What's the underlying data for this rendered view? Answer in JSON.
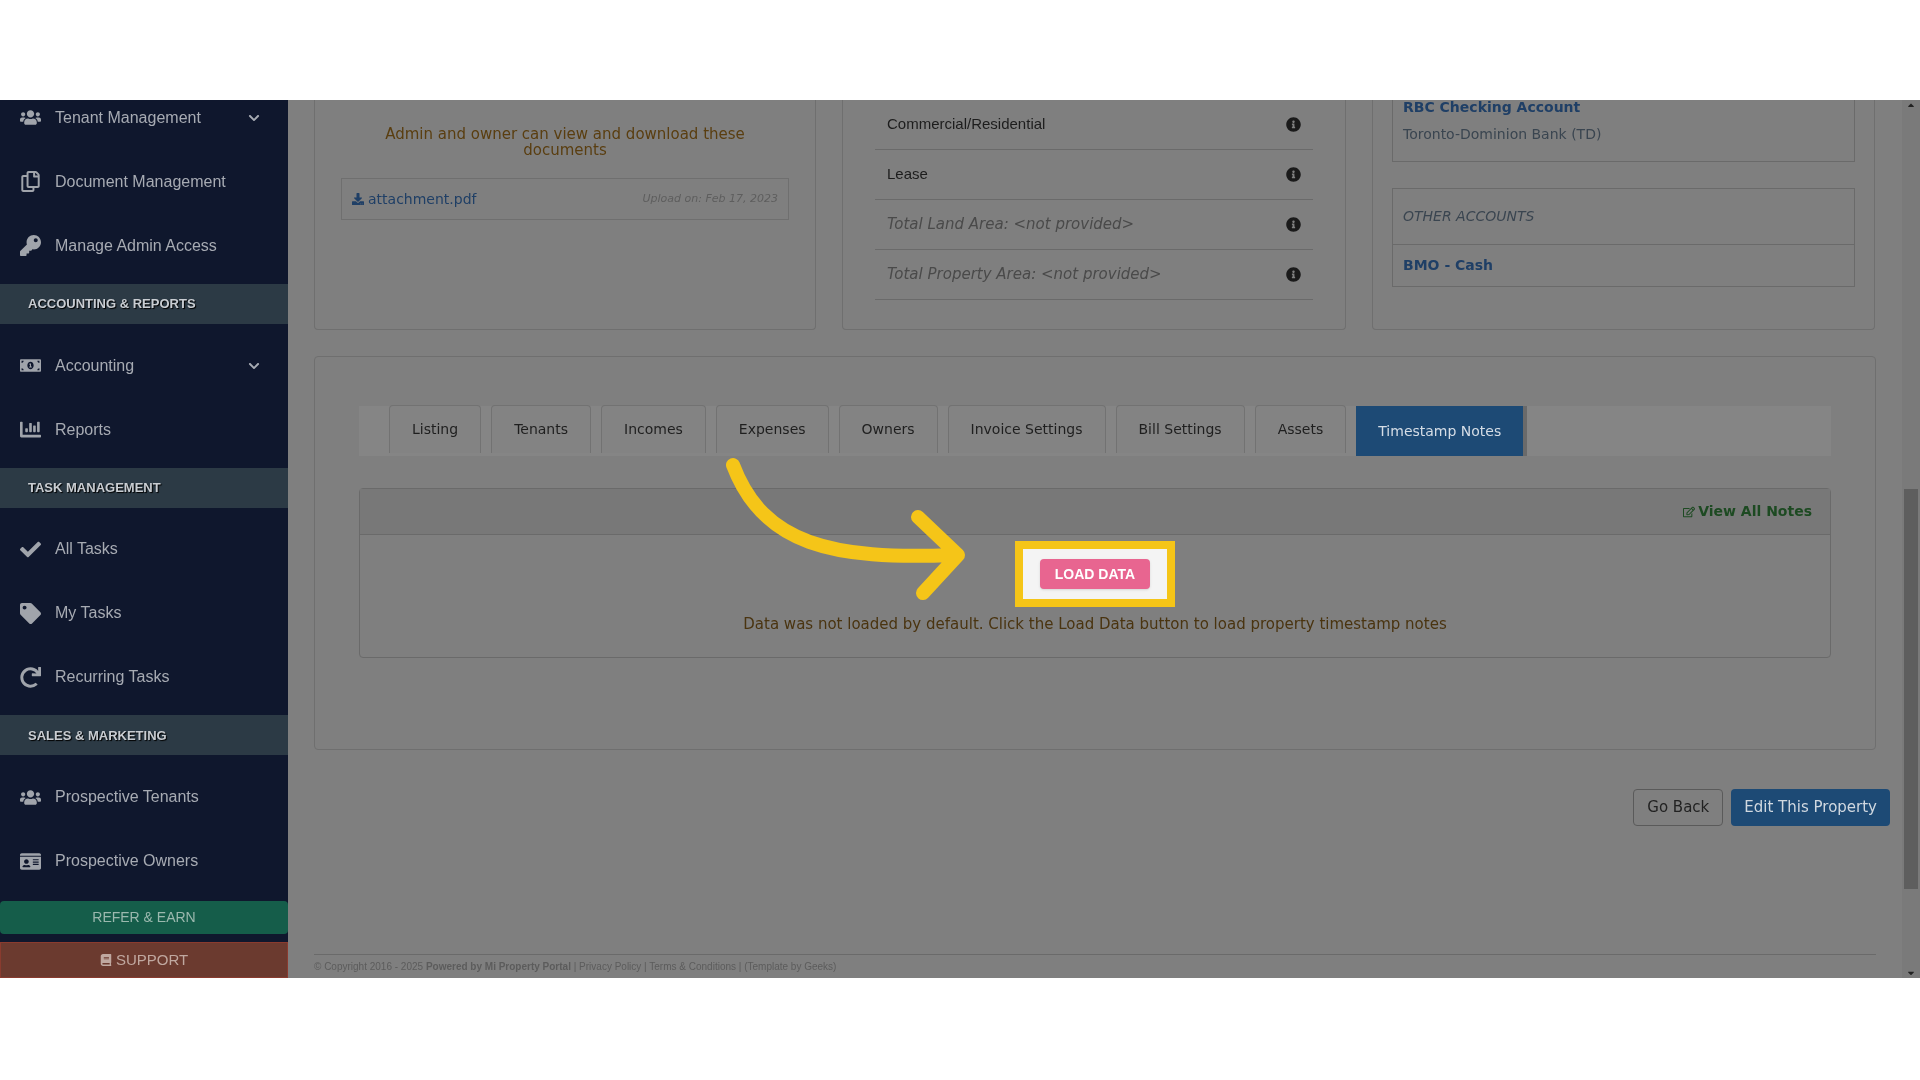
{
  "sidebar": {
    "items": [
      {
        "kind": "item",
        "label": "Tenant Management",
        "has_submenu": true
      },
      {
        "kind": "item",
        "label": "Document Management",
        "has_submenu": false
      },
      {
        "kind": "item",
        "label": "Manage Admin Access",
        "has_submenu": false
      },
      {
        "kind": "header",
        "label": "ACCOUNTING & REPORTS"
      },
      {
        "kind": "item",
        "label": "Accounting",
        "has_submenu": true
      },
      {
        "kind": "item",
        "label": "Reports",
        "has_submenu": false
      },
      {
        "kind": "header",
        "label": "TASK MANAGEMENT"
      },
      {
        "kind": "item",
        "label": "All Tasks",
        "has_submenu": false
      },
      {
        "kind": "item",
        "label": "My Tasks",
        "has_submenu": false
      },
      {
        "kind": "item",
        "label": "Recurring Tasks",
        "has_submenu": false
      },
      {
        "kind": "header",
        "label": "SALES & MARKETING"
      },
      {
        "kind": "item",
        "label": "Prospective Tenants",
        "has_submenu": false
      },
      {
        "kind": "item",
        "label": "Prospective Owners",
        "has_submenu": false
      },
      {
        "kind": "refer",
        "label": "REFER & EARN"
      },
      {
        "kind": "support",
        "label": "SUPPORT"
      }
    ]
  },
  "documents": {
    "heading": "Admin and owner can view and download these documents",
    "files": [
      {
        "name": "attachment.pdf",
        "uploaded": "Upload on: Feb 17, 2023"
      }
    ]
  },
  "property_details": [
    {
      "kind": "value",
      "text": "Commercial/Residential"
    },
    {
      "kind": "value",
      "text": "Lease"
    },
    {
      "kind": "missing",
      "text": "Total Land Area: <not provided>"
    },
    {
      "kind": "missing",
      "text": "Total Property Area: <not provided>"
    }
  ],
  "accounts": {
    "primary": {
      "name": "RBC Checking Account",
      "bank": "Toronto-Dominion Bank (TD)"
    },
    "other_heading": "OTHER ACCOUNTS",
    "other": [
      "BMO - Cash"
    ]
  },
  "tabs": [
    {
      "label": "Listing",
      "selected": false
    },
    {
      "label": "Tenants",
      "selected": false
    },
    {
      "label": "Incomes",
      "selected": false
    },
    {
      "label": "Expenses",
      "selected": false
    },
    {
      "label": "Owners",
      "selected": false
    },
    {
      "label": "Invoice Settings",
      "selected": false
    },
    {
      "label": "Bill Settings",
      "selected": false
    },
    {
      "label": "Assets",
      "selected": false
    },
    {
      "label": "Timestamp Notes",
      "selected": true
    }
  ],
  "notes_panel": {
    "link": "View All Notes",
    "button": "LOAD DATA",
    "message": "Data was not loaded by default. Click the Load Data button to load property timestamp notes"
  },
  "actions": [
    {
      "kind": "secondary",
      "label": "Go Back"
    },
    {
      "kind": "primary",
      "label": "Edit This Property"
    }
  ],
  "footer": "© Copyright 2016 - 2025 **Powered by Mi Property Portal** | Privacy Policy | Terms & Conditions | (Template by Geeks)"
}
